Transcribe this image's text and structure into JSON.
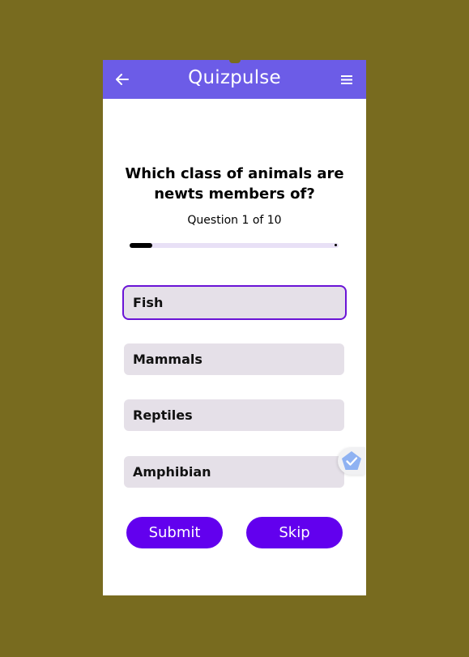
{
  "app": {
    "title": "Quizpulse"
  },
  "icons": {
    "back": "arrow-left-icon",
    "menu": "hamburger-menu-icon",
    "badge": "verified-check-icon"
  },
  "colors": {
    "background": "#786b1f",
    "appbar": "#6c5ce7",
    "accent": "#6200ee",
    "selected_border": "#6a14d6",
    "option_bg": "#e5e0e8",
    "progress_track": "#e8e0f6"
  },
  "quiz": {
    "question": "Which class of animals are newts members of?",
    "progress_label": "Question 1 of 10",
    "current": 1,
    "total": 10,
    "options": [
      {
        "label": "Fish",
        "selected": true
      },
      {
        "label": "Mammals",
        "selected": false
      },
      {
        "label": "Reptiles",
        "selected": false
      },
      {
        "label": "Amphibian",
        "selected": false
      }
    ]
  },
  "actions": {
    "submit_label": "Submit",
    "skip_label": "Skip"
  }
}
